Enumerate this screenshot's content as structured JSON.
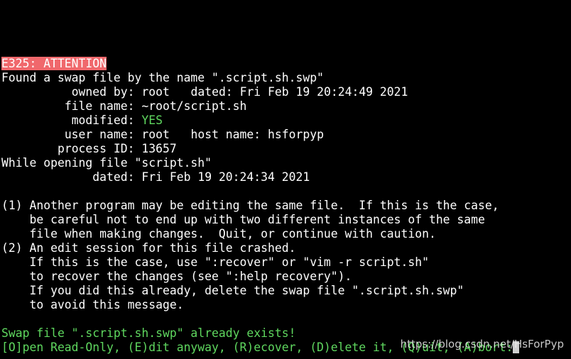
{
  "header": {
    "error_code": "E325: ATTENTION"
  },
  "swap_info": {
    "found_line": "Found a swap file by the name \".script.sh.swp\"",
    "owned_by_label": "owned by:",
    "owned_by_value": "root",
    "dated_label": "dated:",
    "dated_value": "Fri Feb 19 20:24:49 2021",
    "file_name_label": "file name:",
    "file_name_value": "~root/script.sh",
    "modified_label": "modified:",
    "modified_value": "YES",
    "user_name_label": "user name:",
    "user_name_value": "root",
    "host_name_label": "host name:",
    "host_name_value": "hsforpyp",
    "process_id_label": "process ID:",
    "process_id_value": "13657"
  },
  "opening": {
    "line": "While opening file \"script.sh\"",
    "dated_label": "dated:",
    "dated_value": "Fri Feb 19 20:24:34 2021"
  },
  "explanation": {
    "lines": [
      "(1) Another program may be editing the same file.  If this is the case,",
      "    be careful not to end up with two different instances of the same",
      "    file when making changes.  Quit, or continue with caution.",
      "(2) An edit session for this file crashed.",
      "    If this is the case, use \":recover\" or \"vim -r script.sh\"",
      "    to recover the changes (see \":help recovery\").",
      "    If you did this already, delete the swap file \".script.sh.swp\"",
      "    to avoid this message."
    ]
  },
  "prompt": {
    "exists_line": "Swap file \".script.sh.swp\" already exists!",
    "choices_line": "[O]pen Read-Only, (E)dit anyway, (R)ecover, (D)elete it, (Q)uit, (A)bort:"
  },
  "watermark": {
    "text": "https://blog.csdn.net/HsForPyp"
  },
  "colors": {
    "background": "#000000",
    "text": "#ffffff",
    "error_background": "#f0686c",
    "prompt_green": "#5fd75f"
  }
}
